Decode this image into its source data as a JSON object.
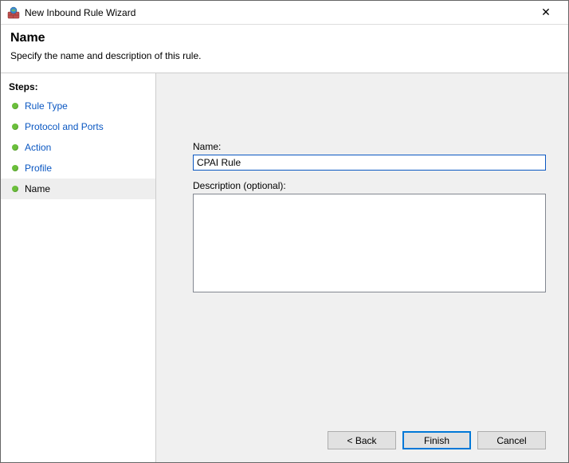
{
  "window": {
    "title": "New Inbound Rule Wizard",
    "close_label": "✕"
  },
  "header": {
    "title": "Name",
    "subtitle": "Specify the name and description of this rule."
  },
  "sidebar": {
    "title": "Steps:",
    "items": [
      {
        "label": "Rule Type",
        "state": "done"
      },
      {
        "label": "Protocol and Ports",
        "state": "done"
      },
      {
        "label": "Action",
        "state": "done"
      },
      {
        "label": "Profile",
        "state": "done"
      },
      {
        "label": "Name",
        "state": "current"
      }
    ]
  },
  "form": {
    "name_label": "Name:",
    "name_value": "CPAI Rule",
    "description_label": "Description (optional):",
    "description_value": ""
  },
  "buttons": {
    "back": "< Back",
    "finish": "Finish",
    "cancel": "Cancel"
  },
  "colors": {
    "link": "#0a57c2",
    "step_bullet": "#6bbf3b",
    "panel_bg": "#f0f0f0",
    "default_btn_border": "#0078d7"
  }
}
